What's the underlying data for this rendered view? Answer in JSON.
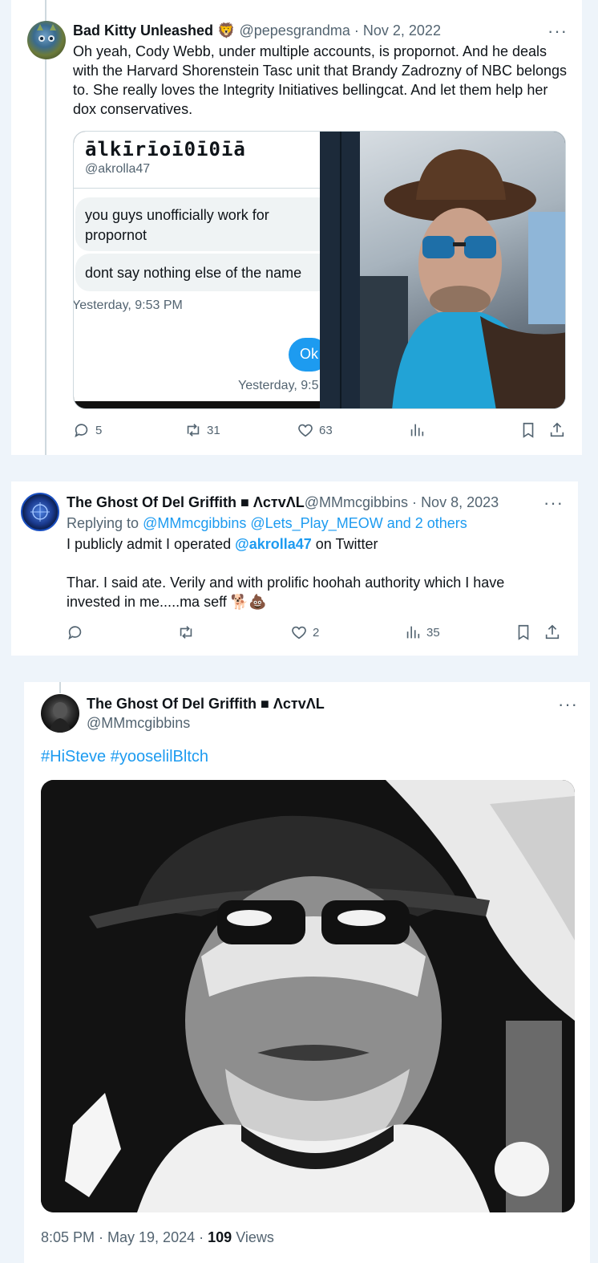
{
  "tweet1": {
    "author_name": "Bad Kitty Unleashed",
    "author_emoji": "🦁",
    "handle": "@pepesgrandma",
    "separator": "·",
    "date": "Nov 2, 2022",
    "more": "···",
    "text": "Oh yeah, Cody Webb, under multiple accounts, is propornot. And he deals with the Harvard Shorenstein Tasc unit that Brandy Zadrozny of NBC belongs to. She really loves the Integrity Initiatives bellingcat. And let them help her dox conservatives.",
    "embed": {
      "dm_title": "ālkīrīoī0ī0īā",
      "dm_handle": "@akrolla47",
      "msg1": "you guys unofficially work for propornot",
      "msg2": "dont say nothing else of the name",
      "time1": "Yesterday, 9:53 PM",
      "reply": "Ok",
      "time2": "Yesterday, 9:5"
    },
    "actions": {
      "replies": "5",
      "retweets": "31",
      "likes": "63"
    }
  },
  "tweet2": {
    "author_name": "The Ghost Of Del Griffith",
    "author_suffix": "■ ΛᴄᴛᴠΛL",
    "handle": "@MMmcgibbins",
    "separator": "·",
    "date": "Nov 8, 2023",
    "more": "···",
    "replying_prefix": "Replying to",
    "replying_to": "@MMmcgibbins @Lets_Play_MEOW and 2 others",
    "line1_pre": "I publicly admit I operated",
    "line1_mention": "@akrolla47",
    "line1_post": "on Twitter",
    "line2": "Thar. I said ate. Verily and with prolific hoohah authority which I have",
    "line3": "invested in me.....ma seff 🐕💩",
    "actions": {
      "likes": "2",
      "views": "35"
    }
  },
  "tweet3": {
    "author_name": "The Ghost Of Del Griffith",
    "author_suffix": "■ ΛᴄᴛᴠΛL",
    "handle": "@MMmcgibbins",
    "more": "···",
    "hashtags": "#HiSteve #yooselilBltch",
    "footer_time": "8:05 PM · May 19, 2024 ·",
    "footer_views": "109",
    "footer_views_label": "Views"
  },
  "colors": {
    "accent": "#1d9bf0",
    "muted": "#536471",
    "bg": "#eef4fa"
  }
}
